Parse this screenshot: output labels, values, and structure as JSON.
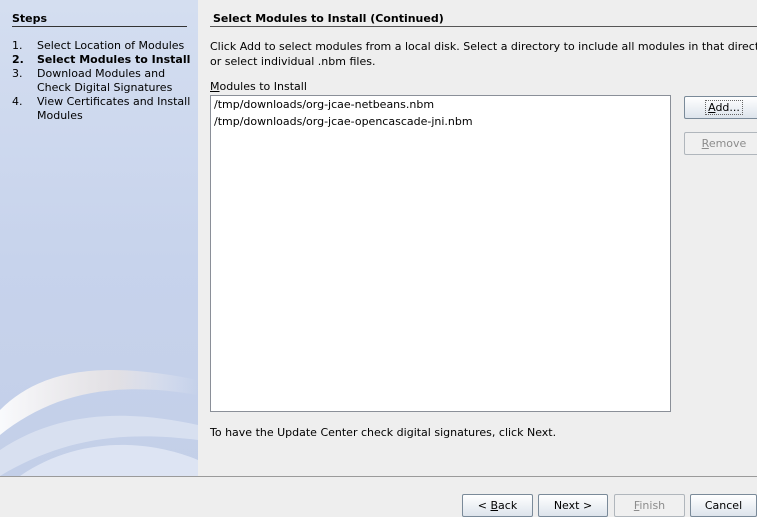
{
  "steps": {
    "title": "Steps",
    "items": [
      {
        "num": "1.",
        "lines": [
          "Select Location of Modules"
        ]
      },
      {
        "num": "2.",
        "lines": [
          "Select Modules to Install"
        ]
      },
      {
        "num": "3.",
        "lines": [
          "Download Modules and",
          "Check Digital Signatures"
        ]
      },
      {
        "num": "4.",
        "lines": [
          "View Certificates and Install",
          "Modules"
        ]
      }
    ]
  },
  "page": {
    "title": "Select Modules to Install (Continued)",
    "description_line1": "Click Add to select modules from a local disk. Select a directory to include all modules in that directory,",
    "description_line2": "or select individual .nbm files.",
    "list_label_mnemonic": "M",
    "list_label_rest": "odules to Install",
    "modules": [
      "/tmp/downloads/org-jcae-netbeans.nbm",
      "/tmp/downloads/org-jcae-opencascade-jni.nbm"
    ],
    "hint": "To have the Update Center check digital signatures, click Next."
  },
  "buttons": {
    "add": {
      "mnemonic": "A",
      "rest": "dd..."
    },
    "remove": {
      "mnemonic": "R",
      "rest": "emove"
    },
    "back": {
      "prefix": "< ",
      "mnemonic": "B",
      "rest": "ack"
    },
    "next": "Next >",
    "finish": {
      "mnemonic": "F",
      "rest": "inish"
    },
    "cancel": "Cancel"
  }
}
